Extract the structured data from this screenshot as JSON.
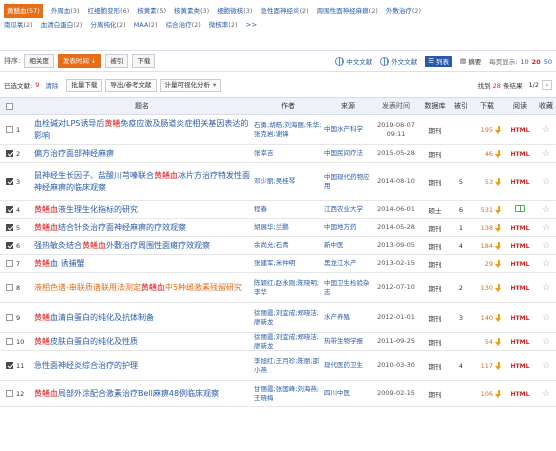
{
  "keywords": {
    "row1": [
      {
        "name": "黄鳝血",
        "count": "(57)",
        "active": true
      },
      {
        "name": "外周血",
        "count": "(3)"
      },
      {
        "name": "红细胞变形",
        "count": "(6)"
      },
      {
        "name": "核黄素",
        "count": "(5)"
      },
      {
        "name": "核黄素类",
        "count": "(3)"
      },
      {
        "name": "细胞微核",
        "count": "(3)"
      },
      {
        "name": "急性面神经炎",
        "count": "(2)"
      },
      {
        "name": "周围性面神经麻痹",
        "count": "(2)"
      },
      {
        "name": "外敷治疗",
        "count": "(2)"
      }
    ],
    "row2": [
      {
        "name": "南瓜氧",
        "count": "(2)"
      },
      {
        "name": "血清白蛋白",
        "count": "(2)"
      },
      {
        "name": "分离纯化",
        "count": "(2)"
      },
      {
        "name": "MAA",
        "count": "(2)"
      },
      {
        "name": "综合治疗",
        "count": "(2)"
      },
      {
        "name": "微核率",
        "count": "(2)"
      }
    ],
    "more": ">>"
  },
  "sortbar": {
    "label": "排序:",
    "buttons": [
      {
        "label": "相关度",
        "active": false
      },
      {
        "label": "发表时间",
        "active": true,
        "arrow": "↓"
      },
      {
        "label": "被引",
        "active": false
      },
      {
        "label": "下载",
        "active": false
      }
    ],
    "lang_cn": "中文文献",
    "lang_en": "外文文献",
    "view_list": "列表",
    "view_abstract": "摘要",
    "perpage_label": "每页显示:",
    "perpage": [
      "10",
      "20",
      "50"
    ],
    "perpage_selected": "20"
  },
  "selbar": {
    "selected_label": "已选文献:",
    "selected_count": "9",
    "clear": "清除",
    "batch_download": "批量下载",
    "export": "导出/参考文献",
    "visual": "计量可视化分析",
    "caret": "▾",
    "found_prefix": "找到",
    "found_count": "28",
    "found_suffix": "条结果",
    "page": "1/2",
    "next": "›"
  },
  "table": {
    "headers": {
      "title": "题名",
      "author": "作者",
      "source": "来源",
      "date": "发表时间",
      "db": "数据库",
      "cite": "被引",
      "download": "下载",
      "read": "阅读",
      "fav": "收藏"
    },
    "rows": [
      {
        "no": "1",
        "checked": false,
        "pre": "血栓碱对LPS诱导后",
        "hl": "黄鳝",
        "post": "免疫应激及肠道炎症相关基因表达的影响",
        "author": "石勇;胡皓;刘海丽;朱华;张克岩;谢锋",
        "source": "中国水产科学",
        "date": "2019-08-07 09:11",
        "db": "期刊",
        "cite": "",
        "download": "195",
        "read": "HTML",
        "alt": false
      },
      {
        "no": "2",
        "checked": true,
        "pre": "偏方治疗面部神经麻痹",
        "hl": "",
        "post": "",
        "author": "张幸吉",
        "source": "中国民间疗法",
        "date": "2015-05-28",
        "db": "期刊",
        "cite": "",
        "download": "46",
        "read": "HTML",
        "alt": false
      },
      {
        "no": "3",
        "checked": true,
        "pre": "鼠神经生长因子、盐酸川芎嗪联合",
        "hl": "黄鳝血",
        "post": "冰片方治疗特发性面神经麻痹的临床观察",
        "author": "邓少丽;吴桂琴",
        "source": "中国现代药物应用",
        "date": "2014-08-10",
        "db": "期刊",
        "cite": "5",
        "download": "53",
        "read": "HTML",
        "alt": false
      },
      {
        "no": "4",
        "checked": true,
        "pre": "",
        "hl": "黄鳝血",
        "post": "液生理生化指标的研究",
        "author": "程春",
        "source": "江西农业大学",
        "date": "2014-06-01",
        "db": "硕士",
        "cite": "6",
        "download": "531",
        "read": "CAJ",
        "alt": false
      },
      {
        "no": "5",
        "checked": true,
        "pre": "",
        "hl": "黄鳝血",
        "post": "结合针灸治疗面神经麻痹的疗效观察",
        "author": "胡展华;兰鹏",
        "source": "中国地方药",
        "date": "2014-05-28",
        "db": "期刊",
        "cite": "1",
        "download": "138",
        "read": "HTML",
        "alt": false
      },
      {
        "no": "6",
        "checked": true,
        "pre": "强热敏灸结合",
        "hl": "黄鳝血",
        "post": "外敷治疗周围性面瘫疗效观察",
        "author": "余尚允;石青",
        "source": "新中医",
        "date": "2013-09-05",
        "db": "期刊",
        "cite": "4",
        "download": "184",
        "read": "HTML",
        "alt": false
      },
      {
        "no": "7",
        "checked": false,
        "pre": "",
        "hl": "黄鳝",
        "post": "血 诱捕蟹",
        "author": "张建军;米仲明",
        "source": "黑龙江水产",
        "date": "2013-02-15",
        "db": "期刊",
        "cite": "",
        "download": "29",
        "read": "HTML",
        "alt": false
      },
      {
        "no": "8",
        "checked": false,
        "pre": "液相色谱-串联质谱联用法测定",
        "hl": "黄鳝血",
        "post": "中5种雌激素残留研究",
        "author": "陈颖红;赵永刚;陈晓明;李华",
        "source": "中国卫生检验杂志",
        "date": "2012-07-10",
        "db": "期刊",
        "cite": "2",
        "download": "130",
        "read": "HTML",
        "alt": true
      },
      {
        "no": "9",
        "checked": false,
        "pre": "",
        "hl": "黄鳝",
        "post": "血清白蛋白的纯化及抗体制备",
        "author": "徐丽霞;刘宜成;郑晓洁;廖新龙",
        "source": "水产养殖",
        "date": "2012-01-01",
        "db": "期刊",
        "cite": "3",
        "download": "140",
        "read": "HTML",
        "alt": false
      },
      {
        "no": "10",
        "checked": false,
        "pre": "",
        "hl": "黄鳝",
        "post": "皮肤白蛋白的纯化及性质",
        "author": "徐丽霞;刘宜成;郑晓洁;廖新龙",
        "source": "热带生物学报",
        "date": "2011-09-25",
        "db": "期刊",
        "cite": "",
        "download": "54",
        "read": "HTML",
        "alt": false
      },
      {
        "no": "11",
        "checked": true,
        "pre": "急性面神经炎综合治疗的护理",
        "hl": "",
        "post": "",
        "author": "李旭红;王月珍;陈丽;邵小燕",
        "source": "现代医药卫生",
        "date": "2010-03-30",
        "db": "期刊",
        "cite": "4",
        "download": "117",
        "read": "HTML",
        "alt": false
      },
      {
        "no": "12",
        "checked": false,
        "pre": "",
        "hl": "黄鳝血",
        "post": "局部外涂配合激素治疗Bell麻痹48例临床观察",
        "author": "甘丽霞;张国峰;刘海燕;王晓梅",
        "source": "四川中医",
        "date": "2009-02-15",
        "db": "期刊",
        "cite": "",
        "download": "106",
        "read": "HTML",
        "alt": false
      }
    ]
  }
}
